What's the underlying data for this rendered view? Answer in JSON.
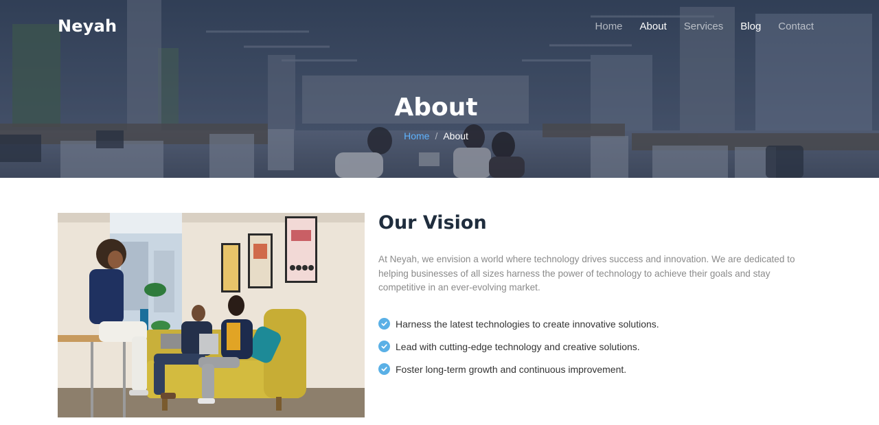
{
  "header": {
    "logo": "Neyah",
    "nav": [
      {
        "label": "Home",
        "active": false
      },
      {
        "label": "About",
        "active": true
      },
      {
        "label": "Services",
        "active": false
      },
      {
        "label": "Blog",
        "active": false
      },
      {
        "label": "Contact",
        "active": false
      }
    ]
  },
  "hero": {
    "title": "About",
    "breadcrumb": {
      "home": "Home",
      "separator": "/",
      "current": "About"
    }
  },
  "vision": {
    "title": "Our Vision",
    "text": "At Neyah, we envision a world where technology drives success and innovation. We are dedicated to helping businesses of all sizes harness the power of technology to achieve their goals and stay competitive in an ever-evolving market.",
    "bullets": [
      "Harness the latest technologies to create innovative solutions.",
      "Lead with cutting-edge technology and creative solutions.",
      "Foster long-term growth and continuous improvement."
    ],
    "icon": "check-circle-icon"
  },
  "colors": {
    "accent": "#5ab0e6",
    "title": "#1f2d3d",
    "body_text": "#8a8a8a",
    "breadcrumb_link": "#5fb3ff"
  }
}
